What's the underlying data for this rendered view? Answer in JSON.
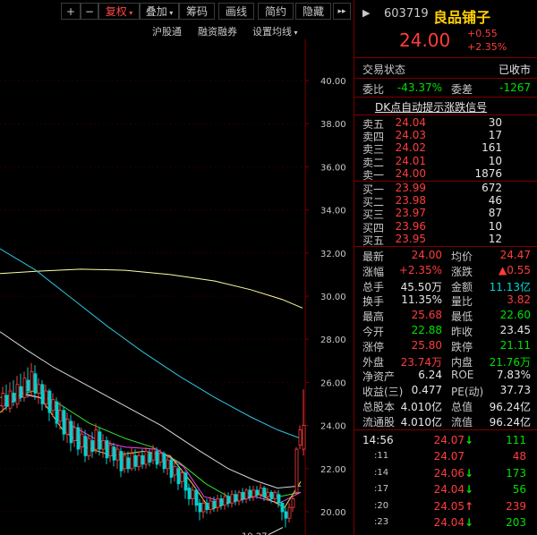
{
  "toolbar": {
    "plus": "+",
    "minus": "−",
    "fuquan": "复权",
    "diejia": "叠加",
    "chouma": "筹码",
    "huaxian": "画线",
    "jianyue": "简约",
    "yincang": "隐藏",
    "expand": "▸▸"
  },
  "subbar": {
    "hugutong": "沪股通",
    "rongzi": "融资融券",
    "settings": "设置均线"
  },
  "chart": {
    "y_labels": [
      "40.00",
      "38.00",
      "36.00",
      "34.00",
      "32.00",
      "30.00",
      "28.00",
      "26.00",
      "24.00",
      "22.00",
      "20.00"
    ],
    "min_label": "19.27",
    "colors": {
      "up": "#ff3c3c",
      "down": "#00d0d0",
      "ma_white": "#d8d8d8",
      "ma_yellow": "#e6d84a",
      "ma_magenta": "#ff40ff",
      "ma_green": "#30e030",
      "ma_cyan": "#2cc6e0",
      "ma_pale": "#ffffa0"
    }
  },
  "quote": {
    "code": "603719",
    "name": "良品铺子",
    "price": "24.00",
    "change": "+0.55",
    "pct": "+2.35%",
    "status_label": "交易状态",
    "status_value": "已收市",
    "weibi_label": "委比",
    "weibi": "-43.37%",
    "weicha_label": "委差",
    "weicha": "-1267",
    "signal": "DK点自动提示涨跌信号"
  },
  "asks": [
    {
      "label": "卖五",
      "price": "24.04",
      "vol": "30"
    },
    {
      "label": "卖四",
      "price": "24.03",
      "vol": "17"
    },
    {
      "label": "卖三",
      "price": "24.02",
      "vol": "161"
    },
    {
      "label": "卖二",
      "price": "24.01",
      "vol": "10"
    },
    {
      "label": "卖一",
      "price": "24.00",
      "vol": "1876"
    }
  ],
  "bids": [
    {
      "label": "买一",
      "price": "23.99",
      "vol": "672"
    },
    {
      "label": "买二",
      "price": "23.98",
      "vol": "46"
    },
    {
      "label": "买三",
      "price": "23.97",
      "vol": "87"
    },
    {
      "label": "买四",
      "price": "23.96",
      "vol": "10"
    },
    {
      "label": "买五",
      "price": "23.95",
      "vol": "12"
    }
  ],
  "stats": [
    {
      "l1": "最新",
      "v1": "24.00",
      "c1": "red",
      "l2": "均价",
      "v2": "24.47",
      "c2": "red"
    },
    {
      "l1": "涨幅",
      "v1": "+2.35%",
      "c1": "red",
      "l2": "涨跌",
      "v2": "▲0.55",
      "c2": "red"
    },
    {
      "l1": "总手",
      "v1": "45.50万",
      "c1": "wht",
      "l2": "金额",
      "v2": "11.13亿",
      "c2": "cyan"
    },
    {
      "l1": "换手",
      "v1": "11.35%",
      "c1": "wht",
      "l2": "量比",
      "v2": "3.82",
      "c2": "red"
    },
    {
      "l1": "最高",
      "v1": "25.68",
      "c1": "red",
      "l2": "最低",
      "v2": "22.60",
      "c2": "grn"
    },
    {
      "l1": "今开",
      "v1": "22.88",
      "c1": "grn",
      "l2": "昨收",
      "v2": "23.45",
      "c2": "wht"
    },
    {
      "l1": "涨停",
      "v1": "25.80",
      "c1": "red",
      "l2": "跌停",
      "v2": "21.11",
      "c2": "grn"
    },
    {
      "l1": "外盘",
      "v1": "23.74万",
      "c1": "red",
      "l2": "内盘",
      "v2": "21.76万",
      "c2": "grn"
    },
    {
      "l1": "净资产",
      "v1": "6.24",
      "c1": "wht",
      "l2": "ROE",
      "v2": "7.83%",
      "c2": "wht"
    },
    {
      "l1": "收益(三)",
      "v1": "0.477",
      "c1": "wht",
      "l2": "PE(动)",
      "v2": "37.73",
      "c2": "wht"
    },
    {
      "l1": "总股本",
      "v1": "4.010亿",
      "c1": "wht",
      "l2": "总值",
      "v2": "96.24亿",
      "c2": "wht"
    },
    {
      "l1": "流通股",
      "v1": "4.010亿",
      "c1": "wht",
      "l2": "流值",
      "v2": "96.24亿",
      "c2": "wht"
    }
  ],
  "ticks": [
    {
      "time": "14:56",
      "price": "24.07",
      "arrow": "↓",
      "vol": "111",
      "acolor": "grn",
      "vcolor": "grn"
    },
    {
      "time": ":11",
      "price": "24.07",
      "arrow": "",
      "vol": "48",
      "acolor": "grn",
      "vcolor": "red"
    },
    {
      "time": ":14",
      "price": "24.06",
      "arrow": "↓",
      "vol": "173",
      "acolor": "grn",
      "vcolor": "grn"
    },
    {
      "time": ":17",
      "price": "24.04",
      "arrow": "↓",
      "vol": "56",
      "acolor": "grn",
      "vcolor": "grn"
    },
    {
      "time": ":20",
      "price": "24.05",
      "arrow": "↑",
      "vol": "239",
      "acolor": "red",
      "vcolor": "red"
    },
    {
      "time": ":23",
      "price": "24.04",
      "arrow": "↓",
      "vol": "203",
      "acolor": "grn",
      "vcolor": "grn"
    }
  ]
}
